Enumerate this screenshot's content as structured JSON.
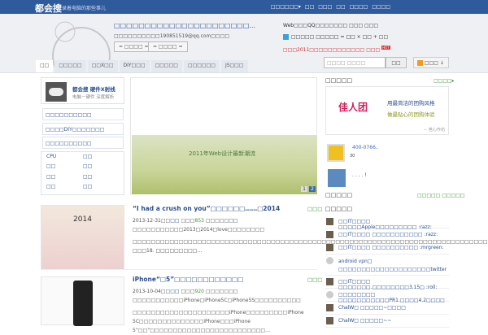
{
  "topbar": {
    "logo": "都会搜",
    "slogan": "记录着电脑的那些事儿",
    "nav": [
      "□□□□□□▾",
      "□□",
      "□□□",
      "□□",
      "□□□□",
      "□□□□"
    ]
  },
  "header": {
    "title": "□□□□□□□□□□□□□□□□□□□□□□…",
    "subtitle": "□□□□□□□□□□190851519@qq.com□□□□",
    "btn1": "= □□□□ =",
    "btn2": "= □□□□ =",
    "right1": "Web□□□QQ□□□□□□□ □□□ □□□",
    "right2": "□□□□□ □□□□□ = □□ × □□ + □□",
    "right3": "□□□2011□□□□□□□□□□□□ □□□",
    "hot": "HOT"
  },
  "tabs": [
    "□□",
    "□□□□□",
    "□□X□□",
    "DIY□□□",
    "□□□□□",
    "□□□□□□",
    "JS□□□"
  ],
  "search": {
    "placeholder": "□□□□ □□□□",
    "button": "□□",
    "rss": "□□□ ↓"
  },
  "sidebar": {
    "brand": "都会搜 硬件X射线",
    "brand_sub": "电脑－硬件 深度解析",
    "links": [
      "□□□□□□□□□□",
      "□□□□DIY□□□□□□□",
      "□□□□□□□□□□"
    ],
    "cats": [
      "CPU",
      "□□",
      "□□",
      "□□",
      "□□",
      "□□",
      "□□",
      "□□"
    ]
  },
  "slider": {
    "caption": "2011年Web设计最新潮流",
    "pages": [
      "1",
      "2"
    ]
  },
  "right": {
    "title1": "□□□□□",
    "more1": "□□□□▸",
    "ad_line1": "用最简洁的团购风格",
    "ad_line2": "做最贴心的团购体验",
    "ad_brand": "佳人团",
    "ad_sign": "－ 茗心作坊",
    "item1": "400-0766..",
    "item1_sub": "30",
    "item2": ". . . .      !",
    "title2": "□□□□□",
    "more2": "□□□□□ □□□□□",
    "title3": "□□□□□",
    "comments": [
      "□□IT□□□□ □□□□□Apple□□□□□□□□□ :razz:",
      "□□IT□□□□ □□□□□□□□□□□ :razz:",
      "□□IT□□□□ □□□□□□□□□□ :mrgreen:",
      "android vpn□ □□□□□□□□□□□□□□□□□□□□twitter □□□□",
      "□□IT□□□□ □□□□□□□.□□□□□□□□3.15□ :roll:",
      "□□□□□□□□ □□□□□□□□□□□PR1.□□□□4.2□□□□",
      "ChalW□ □□□□□~□□□□",
      "ChalW□ □□□□□~~"
    ]
  },
  "posts": [
    {
      "title": "“I had a crush on you”□□□□□□……□2014",
      "meta_date": "2013-12-31□□",
      "meta_a": "□□",
      "meta_b": "□□□",
      "views": "853",
      "meta_c": "□□□□□□□",
      "tags": "□□□□□□□□□□□2013□2014□love□□□□□□□□",
      "excerpt": "□□□□□□□□□□□□□□□□□□□□□□□□□□□□□□□□□□□□□□□□□□□□□□□□□□□□□□□□□□□□□□□□□□□□□□□□□□□□□□□ □□□18. □□□□□□□□□…",
      "cat": "□□□",
      "img_text": "2014"
    },
    {
      "title": "iPhone“□5”□□□□□□□□□□□□",
      "meta_date": "2013-10-04□□",
      "meta_a": "□□",
      "meta_b": "□□□",
      "views": "920",
      "meta_c": "□□□□□□□",
      "tags": "□□□□□□□□□□□iPhone□iPhone5C□iPhone5S□□□□□□□□□□",
      "excerpt": "□□□□□□□□□□□□□□□□□□□□□iPhone□□□□□□□□□iPhone 5C□□□□□□□□□□□□□□iPhone□□□iPhone 5”□□”□□□□□□□□□□□□□□□□□□□□□□□□□…",
      "cat": "□□□"
    }
  ]
}
